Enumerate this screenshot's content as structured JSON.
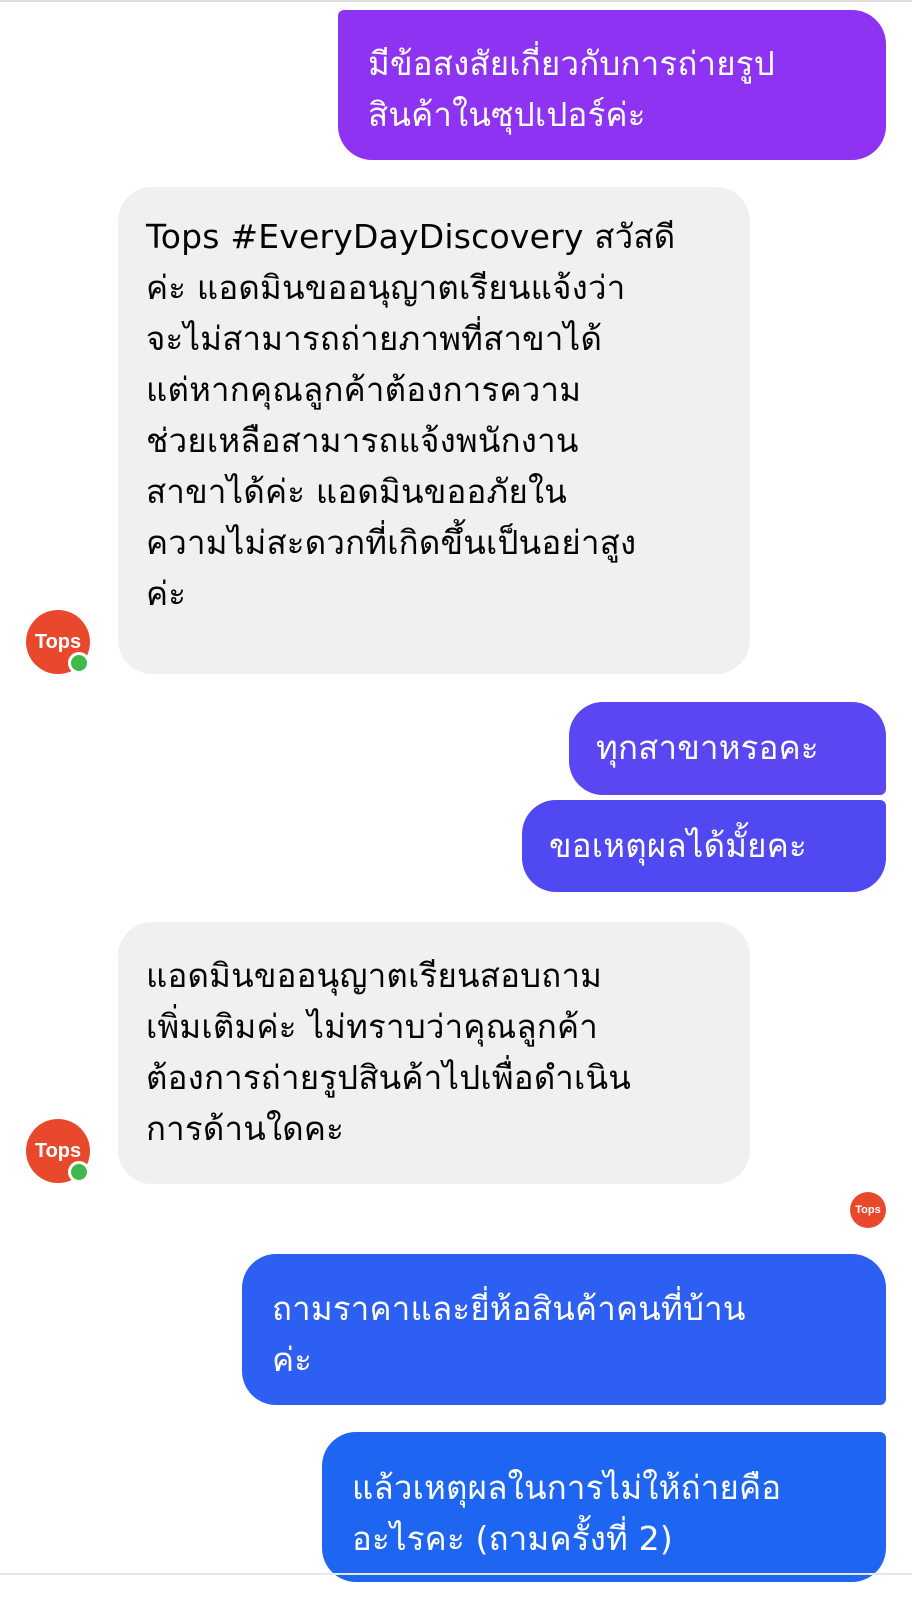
{
  "contact": {
    "avatar_text": "Tops"
  },
  "messages": [
    {
      "from": "user",
      "text": "มีข้อสงสัยเกี่ยวกับการถ่ายรูป\nสินค้าในซุปเปอร์ค่ะ",
      "color": "#8e33f2"
    },
    {
      "from": "page",
      "text": "Tops #EveryDayDiscovery สวัสดี\nค่ะ แอดมินขออนุญาตเรียนแจ้งว่า\nจะไม่สามารถถ่ายภาพที่สาขาได้\nแต่หากคุณลูกค้าต้องการความ\nช่วยเหลือสามารถแจ้งพนักงาน\nสาขาได้ค่ะ แอดมินขออภัยใน\nความไม่สะดวกที่เกิดขึ้นเป็นอย่าสูง\nค่ะ"
    },
    {
      "from": "user",
      "text": "ทุกสาขาหรอคะ",
      "color": "#5a47f2"
    },
    {
      "from": "user",
      "text": "ขอเหตุผลได้มั้ยคะ",
      "color": "#5049f2"
    },
    {
      "from": "page",
      "text": "แอดมินขออนุญาตเรียนสอบถาม\nเพิ่มเติมค่ะ ไม่ทราบว่าคุณลูกค้า\nต้องการถ่ายรูปสินค้าไปเพื่อดำเนิน\nการด้านใดคะ"
    },
    {
      "from": "user",
      "text": "ถามราคาและยี่ห้อสินค้าคนที่บ้าน\nค่ะ",
      "color": "#2d60f2"
    },
    {
      "from": "user",
      "text": "แล้วเหตุผลในการไม่ให้ถ่ายคือ\nอะไรคะ (ถามครั้งที่ 2)",
      "color": "#1e66f2"
    }
  ],
  "seen_indicator": {
    "text": "Tops"
  }
}
